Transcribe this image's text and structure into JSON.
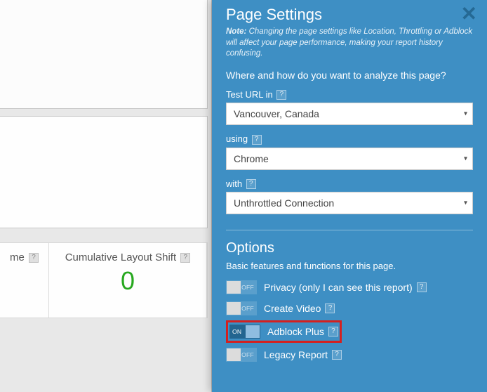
{
  "metrics": {
    "metric1_label": "me",
    "metric2_label": "Cumulative Layout Shift",
    "metric2_value": "0"
  },
  "panel": {
    "title": "Page Settings",
    "note_prefix": "Note:",
    "note_text": " Changing the page settings like Location, Throttling or Adblock will affect your page performance, making your report history confusing.",
    "question": "Where and how do you want to analyze this page?",
    "field1_label": "Test URL in",
    "field1_value": "Vancouver, Canada",
    "field2_label": "using",
    "field2_value": "Chrome",
    "field3_label": "with",
    "field3_value": "Unthrottled Connection"
  },
  "options": {
    "title": "Options",
    "subtitle": "Basic features and functions for this page.",
    "off_text": "OFF",
    "on_text": "ON",
    "item1_label": "Privacy (only I can see this report)",
    "item2_label": "Create Video",
    "item3_label": "Adblock Plus",
    "item4_label": "Legacy Report"
  },
  "help_char": "?"
}
